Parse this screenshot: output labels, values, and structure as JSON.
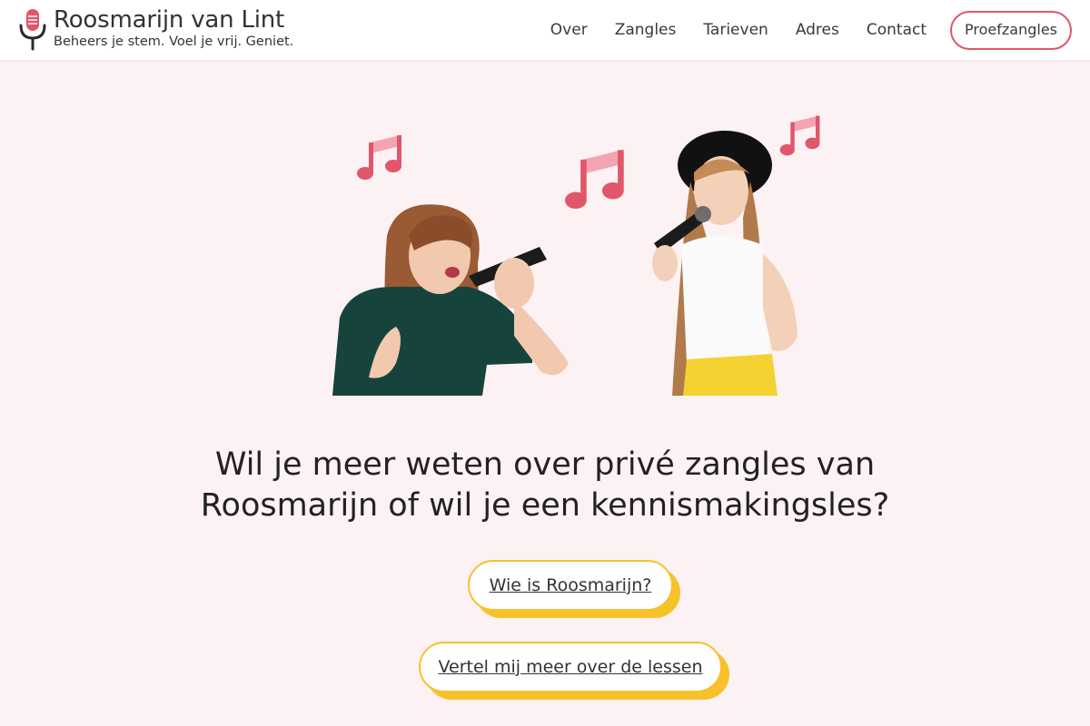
{
  "brand": {
    "name": "Roosmarijn van Lint",
    "tagline": "Beheers je stem. Voel je vrij. Geniet."
  },
  "nav": {
    "items": [
      {
        "label": "Over"
      },
      {
        "label": "Zangles"
      },
      {
        "label": "Tarieven"
      },
      {
        "label": "Adres"
      },
      {
        "label": "Contact"
      }
    ],
    "cta": "Proefzangles"
  },
  "hero": {
    "headline_line1": "Wil je meer weten over privé zangles van",
    "headline_line2": "Roosmarijn of wil je een kennismakingsles?",
    "button_primary": "Wie is Roosmarijn?",
    "button_secondary": "Vertel mij meer over de lessen"
  },
  "colors": {
    "accent_pink": "#e0566b",
    "accent_yellow": "#f7c12a",
    "background": "#fdf2f3"
  },
  "icons": [
    "microphone-icon",
    "music-note-icon"
  ]
}
